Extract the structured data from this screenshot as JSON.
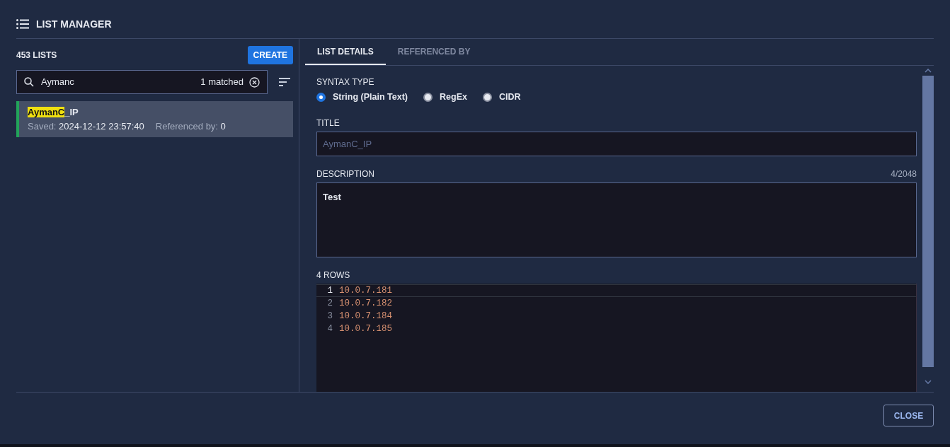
{
  "header": {
    "title": "LIST MANAGER"
  },
  "sidebar": {
    "count": "453 LISTS",
    "create_button": "CREATE",
    "search": {
      "value": "Aymanc",
      "match_count": "1 matched"
    },
    "items": [
      {
        "name_parts": [
          {
            "text": "AymanC",
            "highlighted": true
          },
          {
            "text": "_IP",
            "highlighted": false
          }
        ],
        "saved_label": "Saved:",
        "saved_value": "2024-12-12 23:57:40",
        "ref_label": "Referenced by:",
        "ref_value": "0",
        "selected": true,
        "color": "#22a35a"
      }
    ]
  },
  "tabs": [
    {
      "label": "LIST DETAILS",
      "selected": true
    },
    {
      "label": "REFERENCED BY",
      "selected": false
    }
  ],
  "syntax_type": {
    "label": "SYNTAX TYPE",
    "options": [
      {
        "label": "String (Plain Text)",
        "selected": true
      },
      {
        "label": "RegEx",
        "selected": false
      },
      {
        "label": "CIDR",
        "selected": false
      }
    ]
  },
  "title_field": {
    "label": "TITLE",
    "value": "AymanC_IP",
    "disabled": true
  },
  "description": {
    "label": "DESCRIPTION",
    "counter": "4/2048",
    "value": "Test"
  },
  "rows": {
    "label": "4 ROWS",
    "lines": [
      {
        "number": "1",
        "text": "10.0.7.181",
        "selected": true
      },
      {
        "number": "2",
        "text": "10.0.7.182",
        "selected": false
      },
      {
        "number": "3",
        "text": "10.0.7.184",
        "selected": false
      },
      {
        "number": "4",
        "text": "10.0.7.185",
        "selected": false
      }
    ]
  },
  "footer": {
    "close_button": "CLOSE"
  }
}
